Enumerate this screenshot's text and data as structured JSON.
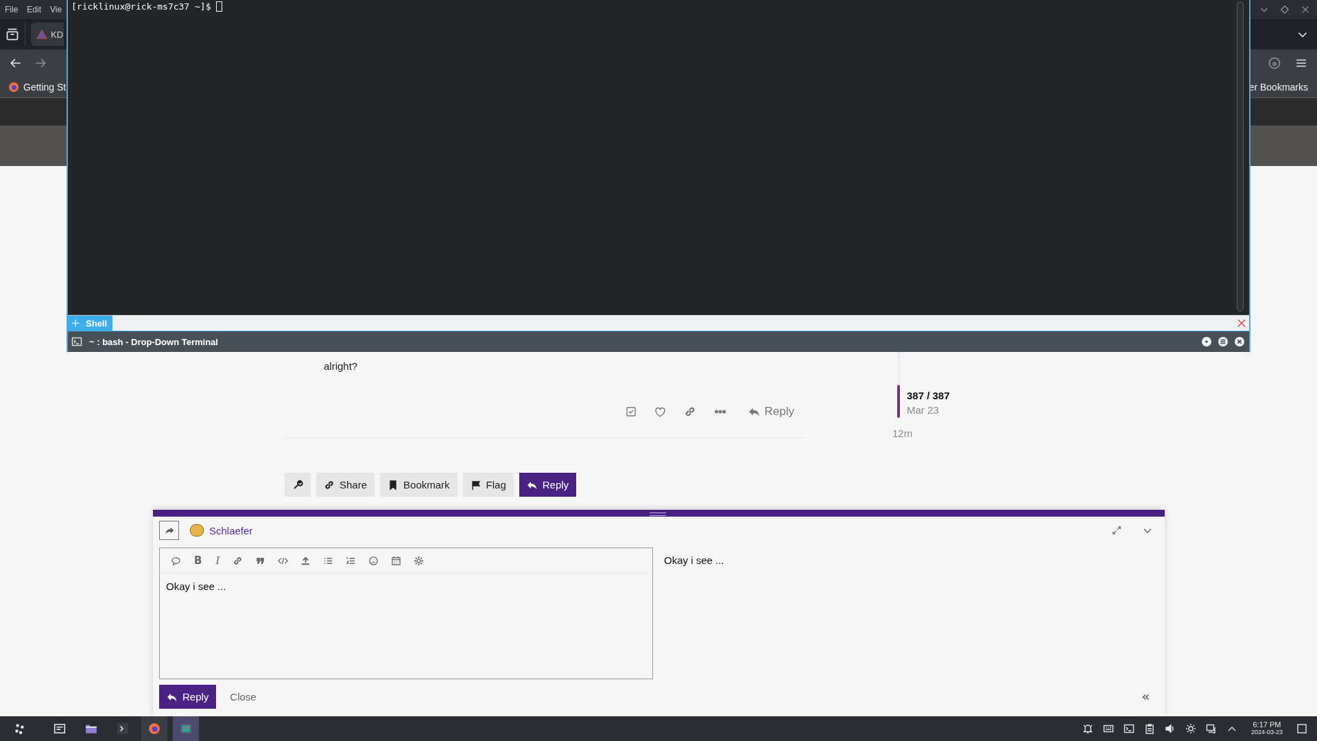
{
  "browser": {
    "menu": [
      {
        "label": "File"
      },
      {
        "label": "Edit"
      },
      {
        "label": "Vie"
      }
    ],
    "tab": {
      "title": "KD"
    },
    "bookmarks": [
      {
        "label": "Getting St"
      },
      {
        "label": "er Bookmarks"
      }
    ]
  },
  "terminal": {
    "prompt": "[ricklinux@rick-ms7c37 ~]$ ",
    "tabs": [
      {
        "label": "Shell",
        "selected": true
      }
    ],
    "title": "~ : bash - Drop-Down Terminal"
  },
  "post": {
    "text": "alright?",
    "reply_label": "Reply"
  },
  "timeline": {
    "position": "387 / 387",
    "date": "Mar 23",
    "age": "12m"
  },
  "topic_buttons": [
    {
      "kind": "icon"
    },
    {
      "kind": "default",
      "label": "Share"
    },
    {
      "kind": "default",
      "label": "Bookmark"
    },
    {
      "kind": "default",
      "label": "Flag"
    },
    {
      "kind": "primary",
      "label": "Reply"
    }
  ],
  "composer": {
    "user": "Schlaefer",
    "toolbar": [
      {
        "kind": "icon"
      },
      {
        "kind": "bold",
        "label": "B"
      },
      {
        "kind": "italic",
        "label": "I"
      },
      {
        "kind": "icon"
      },
      {
        "kind": "icon"
      },
      {
        "kind": "icon"
      },
      {
        "kind": "icon"
      },
      {
        "kind": "icon"
      },
      {
        "kind": "icon"
      },
      {
        "kind": "icon"
      },
      {
        "kind": "icon"
      },
      {
        "kind": "icon"
      }
    ],
    "value": "Okay i see ...",
    "preview": "Okay i see ...",
    "submit": "Reply",
    "cancel": "Close"
  },
  "taskbar": {
    "tasks": [
      {
        "running": false,
        "selected": false
      },
      {
        "running": false,
        "selected": false
      },
      {
        "running": false,
        "selected": false
      },
      {
        "running": true,
        "selected": false
      },
      {
        "running": true,
        "selected": true
      }
    ],
    "time": "6:17 PM",
    "date": "2024-03-23"
  }
}
